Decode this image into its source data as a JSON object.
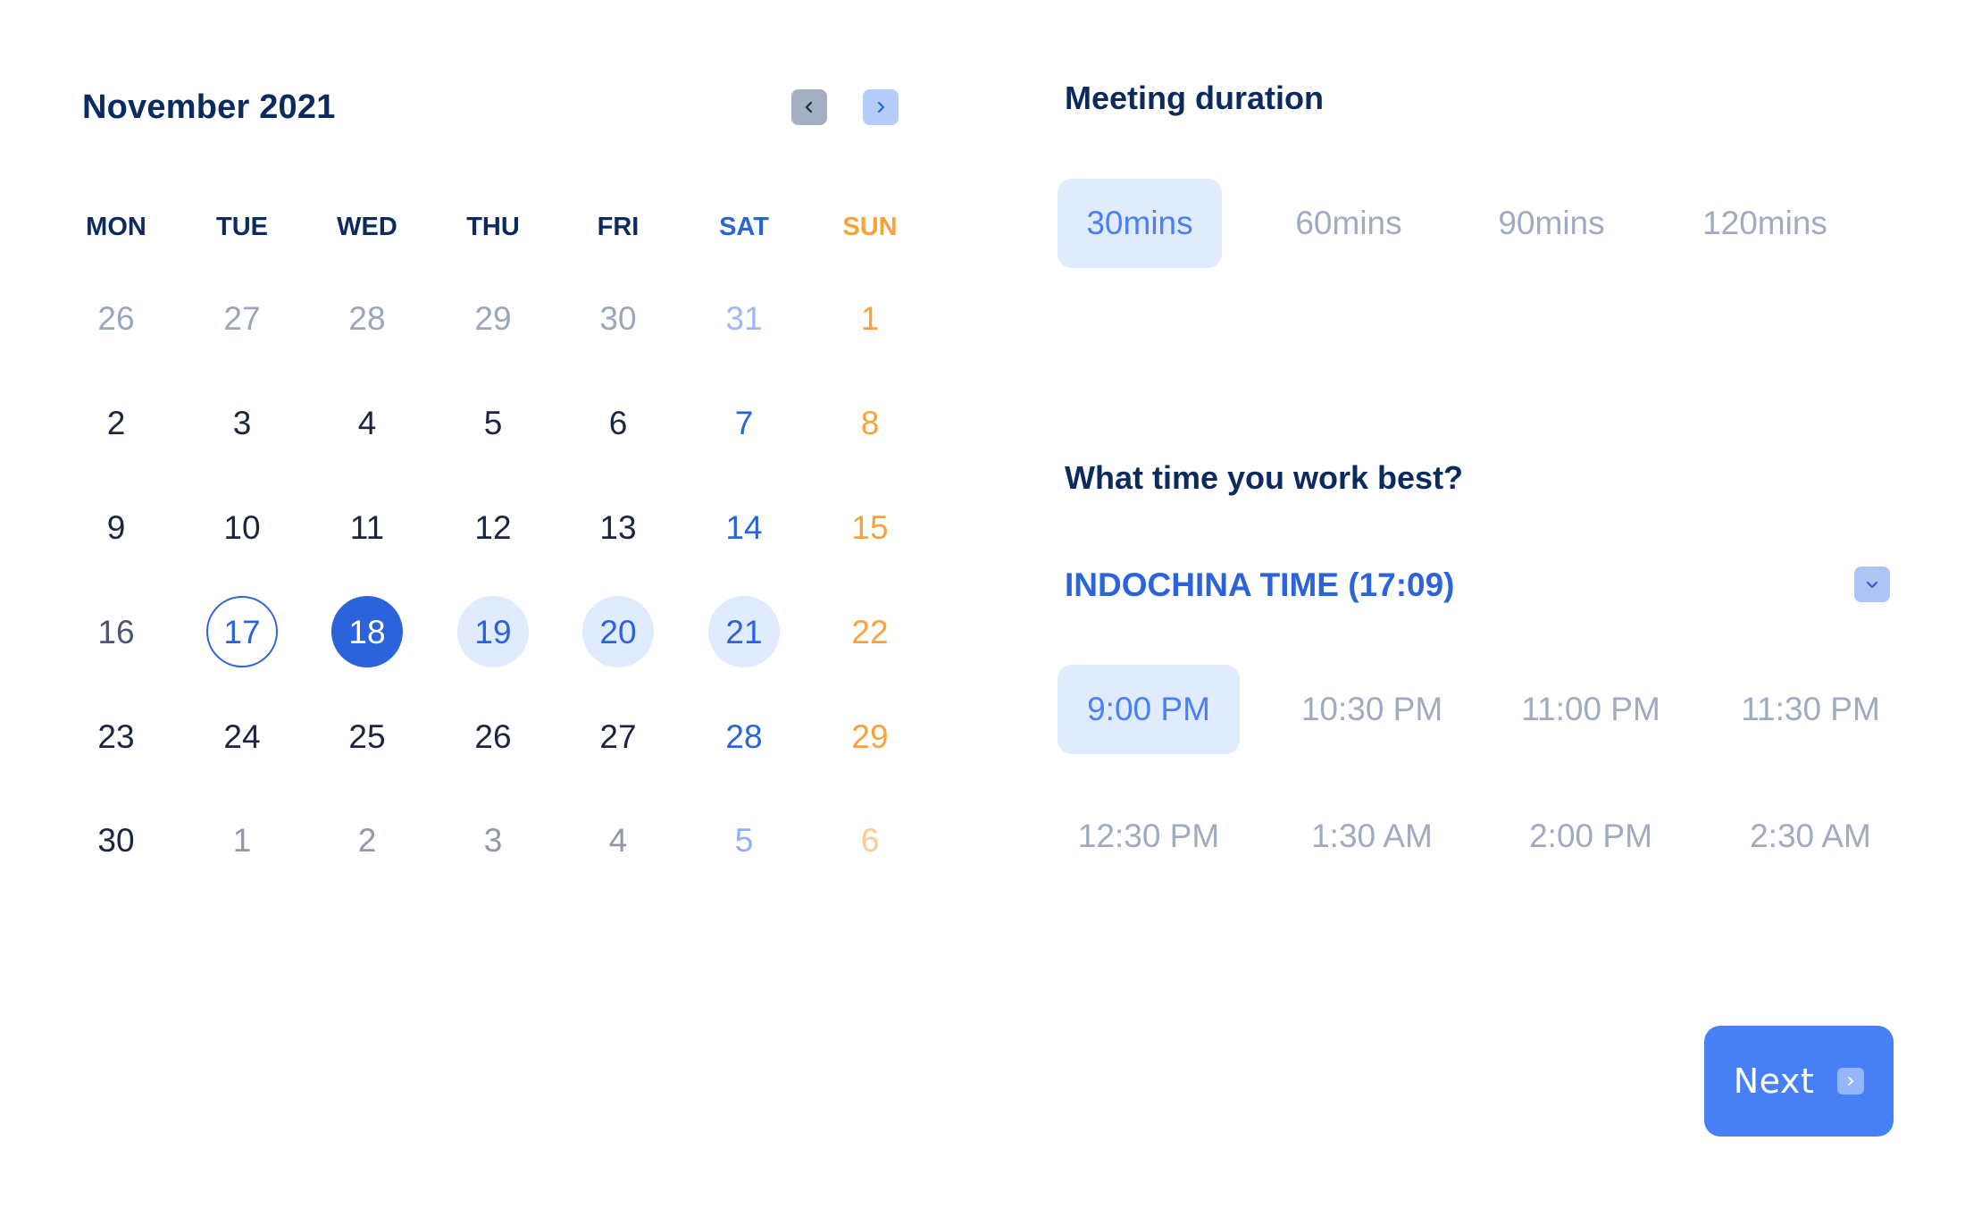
{
  "calendar": {
    "month_title": "November 2021",
    "prev_icon": "chevron-left-icon",
    "next_icon": "chevron-right-icon",
    "weekdays": [
      "MON",
      "TUE",
      "WED",
      "THU",
      "FRI",
      "SAT",
      "SUN"
    ],
    "weeks": [
      [
        {
          "d": "26",
          "s": "muted"
        },
        {
          "d": "27",
          "s": "muted"
        },
        {
          "d": "28",
          "s": "muted"
        },
        {
          "d": "29",
          "s": "muted"
        },
        {
          "d": "30",
          "s": "muted"
        },
        {
          "d": "31",
          "s": "muted-sat"
        },
        {
          "d": "1",
          "s": "muted-sun"
        }
      ],
      [
        {
          "d": "2",
          "s": "normal"
        },
        {
          "d": "3",
          "s": "normal"
        },
        {
          "d": "4",
          "s": "normal"
        },
        {
          "d": "5",
          "s": "normal"
        },
        {
          "d": "6",
          "s": "normal"
        },
        {
          "d": "7",
          "s": "sat"
        },
        {
          "d": "8",
          "s": "sun"
        }
      ],
      [
        {
          "d": "9",
          "s": "normal"
        },
        {
          "d": "10",
          "s": "normal"
        },
        {
          "d": "11",
          "s": "normal"
        },
        {
          "d": "12",
          "s": "normal"
        },
        {
          "d": "13",
          "s": "normal"
        },
        {
          "d": "14",
          "s": "sat"
        },
        {
          "d": "15",
          "s": "sun"
        }
      ],
      [
        {
          "d": "16",
          "s": "slate"
        },
        {
          "d": "17",
          "s": "today"
        },
        {
          "d": "18",
          "s": "selected"
        },
        {
          "d": "19",
          "s": "range"
        },
        {
          "d": "20",
          "s": "range"
        },
        {
          "d": "21",
          "s": "range"
        },
        {
          "d": "22",
          "s": "sun"
        }
      ],
      [
        {
          "d": "23",
          "s": "normal"
        },
        {
          "d": "24",
          "s": "normal"
        },
        {
          "d": "25",
          "s": "normal"
        },
        {
          "d": "26",
          "s": "normal"
        },
        {
          "d": "27",
          "s": "normal"
        },
        {
          "d": "28",
          "s": "sat"
        },
        {
          "d": "29",
          "s": "sun"
        }
      ],
      [
        {
          "d": "30",
          "s": "normal"
        },
        {
          "d": "1",
          "s": "next-muted"
        },
        {
          "d": "2",
          "s": "next-muted"
        },
        {
          "d": "3",
          "s": "next-muted"
        },
        {
          "d": "4",
          "s": "next-muted"
        },
        {
          "d": "5",
          "s": "next-muted-sat"
        },
        {
          "d": "6",
          "s": "next-muted-sun"
        }
      ]
    ],
    "today": "17",
    "selected": "18",
    "highlighted_range": [
      "19",
      "20",
      "21"
    ]
  },
  "duration": {
    "title": "Meeting duration",
    "options": [
      {
        "label": "30mins",
        "active": true
      },
      {
        "label": "60mins",
        "active": false
      },
      {
        "label": "90mins",
        "active": false
      },
      {
        "label": "120mins",
        "active": false
      }
    ]
  },
  "time": {
    "title": "What time you work best?",
    "timezone_label": "INDOCHINA TIME (17:09)",
    "timezone_toggle_icon": "chevron-down-icon",
    "slots": [
      {
        "label": "9:00 PM",
        "active": true
      },
      {
        "label": "10:30 PM",
        "active": false
      },
      {
        "label": "11:00 PM",
        "active": false
      },
      {
        "label": "11:30 PM",
        "active": false
      },
      {
        "label": "12:30 PM",
        "active": false
      },
      {
        "label": "1:30 AM",
        "active": false
      },
      {
        "label": "2:00 PM",
        "active": false
      },
      {
        "label": "2:30 AM",
        "active": false
      }
    ]
  },
  "footer": {
    "next_label": "Next",
    "next_icon": "chevron-right-icon"
  },
  "colors": {
    "primary": "#2B63DB",
    "button": "#4780F5",
    "heading": "#0B2A5E",
    "weekend_sun": "#F9A23B",
    "highlight_bg": "#E0EBFD",
    "muted_text": "#9FABC0"
  }
}
